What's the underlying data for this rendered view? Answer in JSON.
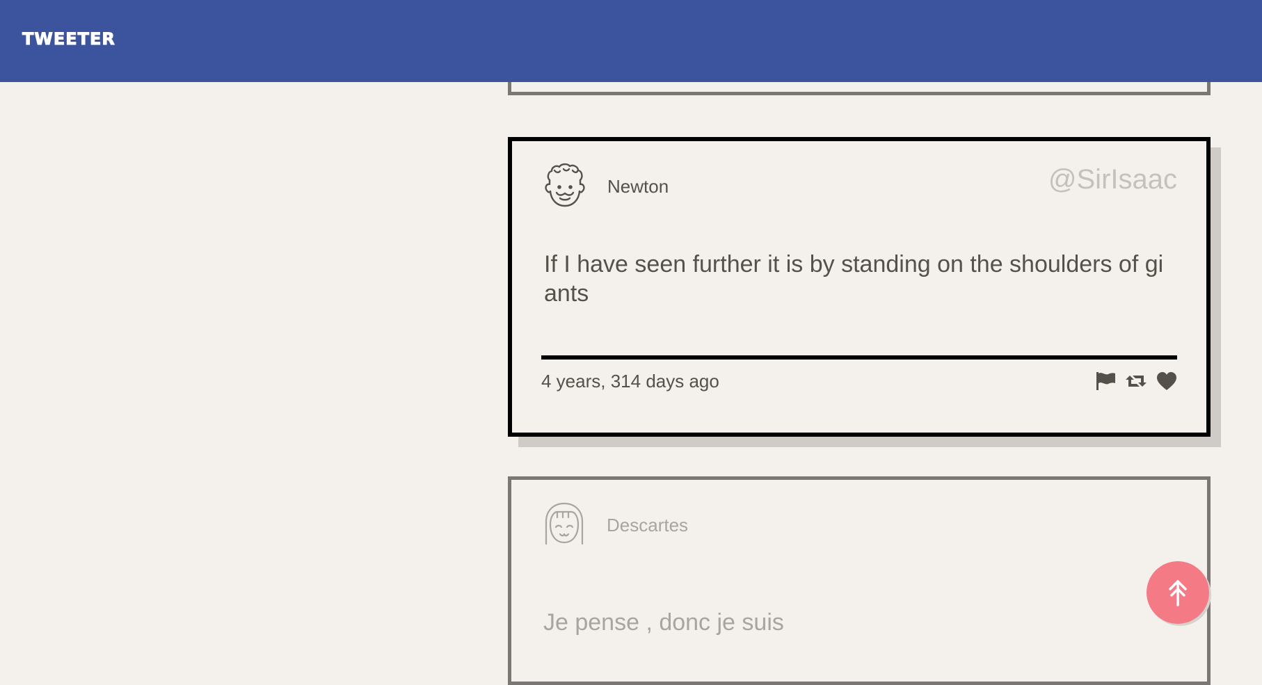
{
  "app": {
    "logo": "TWEETER"
  },
  "tweets": [
    {
      "author": "Newton",
      "handle": "@SirIsaac",
      "message": "If I have seen further it is by standing on the shoulders of giants",
      "time": "4 years, 314 days ago",
      "avatar_icon": "man-face-icon"
    },
    {
      "author": "Descartes",
      "message": "Je pense , donc je suis",
      "avatar_icon": "woman-face-icon"
    }
  ],
  "actions": {
    "flag_icon": "flag-icon",
    "retweet_icon": "retweet-icon",
    "like_icon": "heart-icon"
  },
  "colors": {
    "header": "#3c549e",
    "background": "#f4f1ec",
    "scroll_button": "#f47a86",
    "text": "#555049",
    "muted_text": "#a8a49e"
  }
}
